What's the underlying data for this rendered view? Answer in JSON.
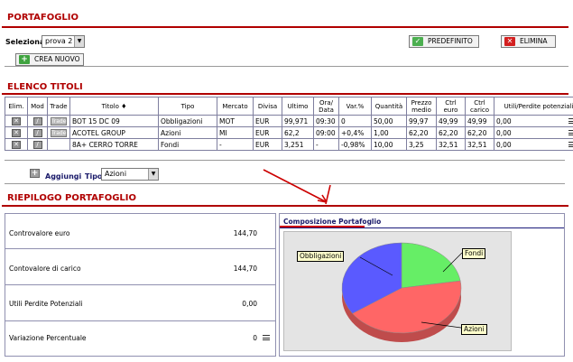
{
  "header": {
    "title": "PORTAFOGLIO"
  },
  "selection": {
    "label": "Seleziona",
    "value": "prova 2"
  },
  "buttons": {
    "predefinito": "PREDEFINITO",
    "elimina": "ELIMINA",
    "crea_nuovo": "CREA NUOVO"
  },
  "titles_section": {
    "title": "ELENCO TITOLI",
    "columns": [
      "Elim.",
      "Mod",
      "Trade",
      "Titolo",
      "Tipo",
      "Mercato",
      "Divisa",
      "Ultimo",
      "Ora/ Data",
      "Var.%",
      "Quantità",
      "Prezzo medio",
      "Ctrl euro",
      "Ctrl carico",
      "Utili/Perdite potenziali"
    ],
    "rows": [
      {
        "titolo": "BOT 15 DC 09",
        "tipo": "Obbligazioni",
        "mercato": "MOT",
        "divisa": "EUR",
        "ultimo": "99,971",
        "ora": "09:30",
        "var": "0",
        "quantita": "50,00",
        "prezzo": "99,97",
        "ctrl_euro": "49,99",
        "ctrl_carico": "49,99",
        "utili": "0,00",
        "trade": true
      },
      {
        "titolo": "ACOTEL GROUP",
        "tipo": "Azioni",
        "mercato": "MI",
        "divisa": "EUR",
        "ultimo": "62,2",
        "ora": "09:00",
        "var": "+0,4%",
        "quantita": "1,00",
        "prezzo": "62,20",
        "ctrl_euro": "62,20",
        "ctrl_carico": "62,20",
        "utili": "0,00",
        "trade": true
      },
      {
        "titolo": "8A+ CERRO TORRE",
        "tipo": "Fondi",
        "mercato": "-",
        "divisa": "EUR",
        "ultimo": "3,251",
        "ora": "-",
        "var": "-0,98%",
        "quantita": "10,00",
        "prezzo": "3,25",
        "ctrl_euro": "32,51",
        "ctrl_carico": "32,51",
        "utili": "0,00",
        "trade": false
      }
    ],
    "trade_icon_label": "Trade",
    "add_label": "Aggiungi",
    "type_label": "Tipo",
    "type_value": "Azioni"
  },
  "summary_section": {
    "title": "RIEPILOGO PORTAFOGLIO",
    "rows": [
      {
        "label": "Controvalore euro",
        "value": "144,70"
      },
      {
        "label": "Contovalore di carico",
        "value": "144,70"
      },
      {
        "label": "Utili Perdite Potenziali",
        "value": "0,00"
      },
      {
        "label": "Variazione Percentuale",
        "value": "0"
      }
    ]
  },
  "chart_data": {
    "type": "pie",
    "title": "Composizione Portafoglio",
    "slices": [
      {
        "name": "Obbligazioni",
        "value": 49.99,
        "color": "#5a5aff"
      },
      {
        "name": "Fondi",
        "value": 32.51,
        "color": "#66ee66"
      },
      {
        "name": "Azioni",
        "value": 62.2,
        "color": "#ff6666"
      }
    ]
  },
  "colors": {
    "accent": "#b00000",
    "annotation_arrow": "#cc0000"
  }
}
